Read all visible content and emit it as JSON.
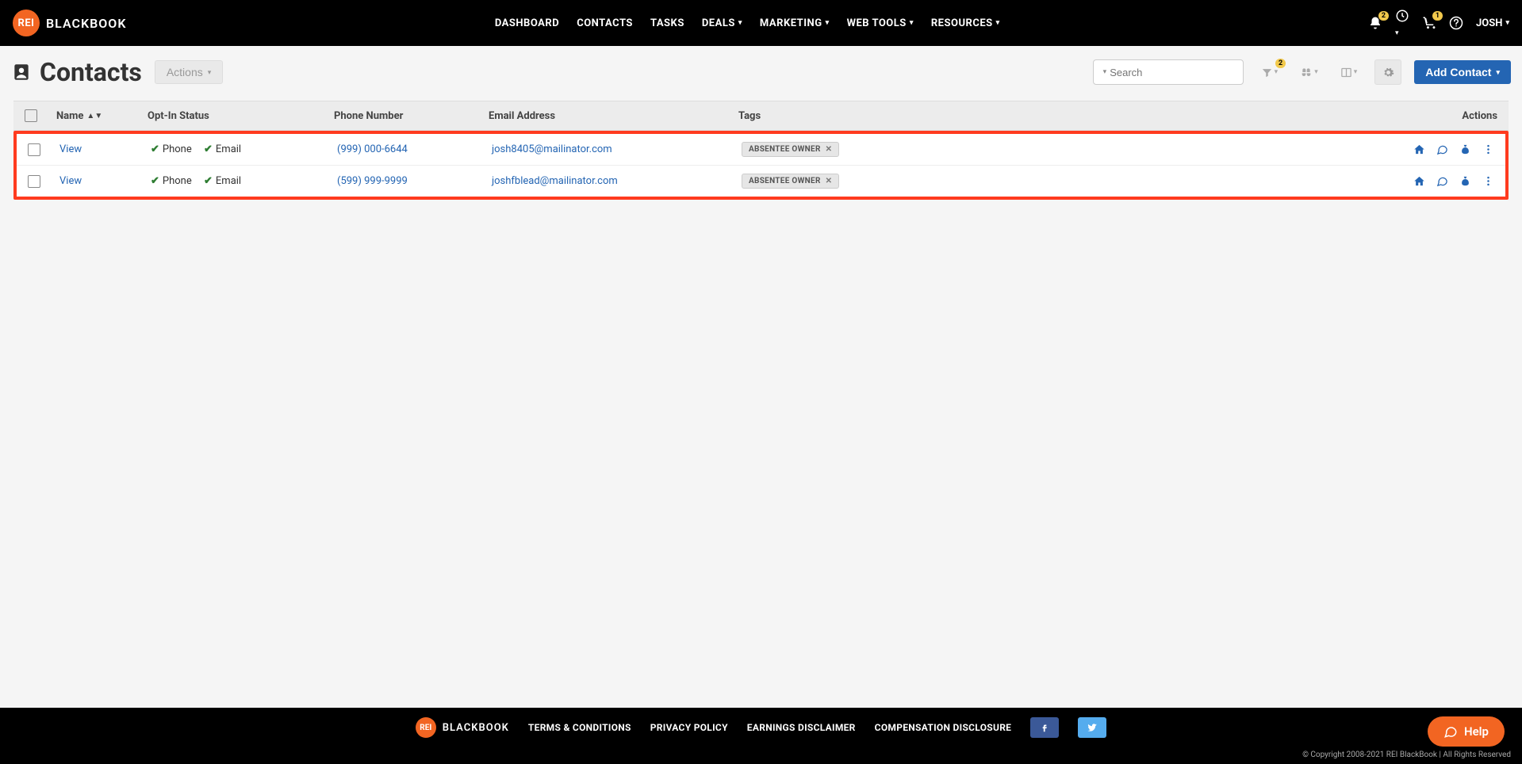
{
  "brand": {
    "badge": "REI",
    "name": "BLACKBOOK"
  },
  "nav": {
    "items": [
      {
        "label": "DASHBOARD",
        "dropdown": false
      },
      {
        "label": "CONTACTS",
        "dropdown": false
      },
      {
        "label": "TASKS",
        "dropdown": false
      },
      {
        "label": "DEALS",
        "dropdown": true
      },
      {
        "label": "MARKETING",
        "dropdown": true
      },
      {
        "label": "WEB TOOLS",
        "dropdown": true
      },
      {
        "label": "RESOURCES",
        "dropdown": true
      }
    ],
    "notif_count": "2",
    "cart_count": "1",
    "user": "JOSH"
  },
  "page": {
    "title": "Contacts",
    "actions_btn": "Actions",
    "search_placeholder": "Search",
    "filter_badge": "2",
    "add_contact": "Add Contact"
  },
  "table": {
    "headers": {
      "name": "Name",
      "optin": "Opt-In Status",
      "phone": "Phone Number",
      "email": "Email Address",
      "tags": "Tags",
      "actions": "Actions"
    },
    "rows": [
      {
        "view": "View",
        "optin_phone": "Phone",
        "optin_email": "Email",
        "phone": "(999) 000-6644",
        "email": "josh8405@mailinator.com",
        "tag": "ABSENTEE OWNER"
      },
      {
        "view": "View",
        "optin_phone": "Phone",
        "optin_email": "Email",
        "phone": "(599) 999-9999",
        "email": "joshfblead@mailinator.com",
        "tag": "ABSENTEE OWNER"
      }
    ]
  },
  "footer": {
    "links": [
      "TERMS & CONDITIONS",
      "PRIVACY POLICY",
      "EARNINGS DISCLAIMER",
      "COMPENSATION DISCLOSURE"
    ],
    "copyright": "© Copyright 2008-2021 REI BlackBook | All Rights Reserved"
  },
  "help": {
    "label": "Help"
  }
}
